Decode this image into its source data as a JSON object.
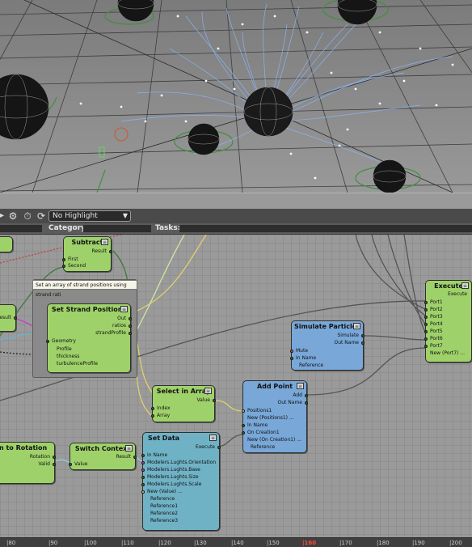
{
  "toolbar": {
    "highlight_value": "No Highlight"
  },
  "category_bar": {
    "category_label": "Category:",
    "tasks_label": "Tasks:"
  },
  "group": {
    "tooltip": "Set an array of strand positions using strand rati"
  },
  "nodes": {
    "subtract": {
      "title": "Subtract",
      "out": "Result",
      "in1": "First",
      "in2": "Second"
    },
    "left_result": {
      "out": "Result"
    },
    "set_strand_positions": {
      "title": "Set Strand Positions",
      "out1": "Out",
      "out2": "ratios",
      "out3": "strandProfile",
      "in1": "Geometry",
      "in2": "Profile",
      "in3": "thickness",
      "in4": "turbulenceProfile"
    },
    "simulate_particles": {
      "title": "Simulate Particles",
      "out1": "Simulate",
      "out2": "Out Name",
      "in1": "Mute",
      "in2": "In Name",
      "in3": "Reference"
    },
    "execute": {
      "title": "Execute",
      "out": "Execute",
      "ports": [
        "Port1",
        "Port2",
        "Port3",
        "Port4",
        "Port5",
        "Port6",
        "Port7",
        "New (Port7) ..."
      ]
    },
    "select_in_array": {
      "title": "Select in Array",
      "out": "Value",
      "in1": "Index",
      "in2": "Array"
    },
    "add_point": {
      "title": "Add Point",
      "out1": "Add",
      "out2": "Out Name",
      "ports": [
        "Positions1",
        "New (Positions1) ...",
        "In Name",
        "On Creation1",
        "New (On Creation1) ...",
        "Reference"
      ]
    },
    "set_data": {
      "title": "Set Data",
      "out": "Execute",
      "ports": [
        "In Name",
        "Modelers.Lughts.Orientation",
        "Modelers.Lughts.Base",
        "Modelers.Lughts.Size",
        "Modelers.Lughts.Scale",
        "New (Value) ...",
        "Reference",
        "Reference1",
        "Reference2",
        "Reference3"
      ]
    },
    "to_rotation": {
      "title": "n to Rotation",
      "out1": "Rotation",
      "out2": "Valid"
    },
    "switch_context": {
      "title": "Switch Context",
      "out": "Result",
      "in": "Value"
    }
  },
  "ruler": {
    "ticks": [
      "|80",
      "|90",
      "|100",
      "|110",
      "|120",
      "|130",
      "|140",
      "|150",
      "|160",
      "|170",
      "|180",
      "|190",
      "|200"
    ],
    "current": "|160"
  },
  "colors": {
    "green_node": "#9fd16a",
    "blue_node": "#78a7d8",
    "teal_node": "#6fb2c6",
    "current_frame": "#ff4a3a",
    "strands": "#8ab8ff"
  }
}
